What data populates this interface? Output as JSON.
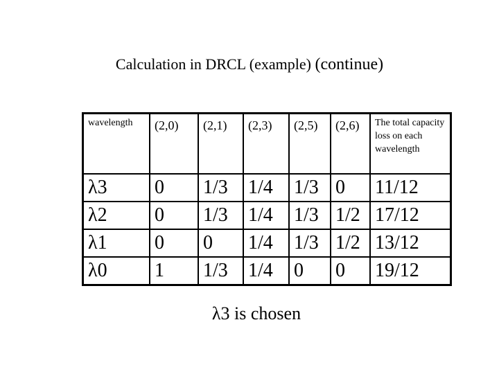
{
  "slide": {
    "title_main": "Calculation in DRCL (example) ",
    "title_suffix": "(continue)",
    "footer": "λ3 is chosen"
  },
  "table": {
    "headers": [
      "wavelength",
      "(2,0)",
      "(2,1)",
      "(2,3)",
      "(2,5)",
      "(2,6)",
      "The total capacity loss on each wavelength"
    ],
    "rows": [
      [
        "λ3",
        "0",
        "1/3",
        "1/4",
        "1/3",
        "0",
        "11/12"
      ],
      [
        "λ2",
        "0",
        "1/3",
        "1/4",
        "1/3",
        "1/2",
        "17/12"
      ],
      [
        "λ1",
        "0",
        "0",
        "1/4",
        "1/3",
        "1/2",
        "13/12"
      ],
      [
        "λ0",
        "1",
        "1/3",
        "1/4",
        "0",
        "0",
        "19/12"
      ]
    ]
  }
}
